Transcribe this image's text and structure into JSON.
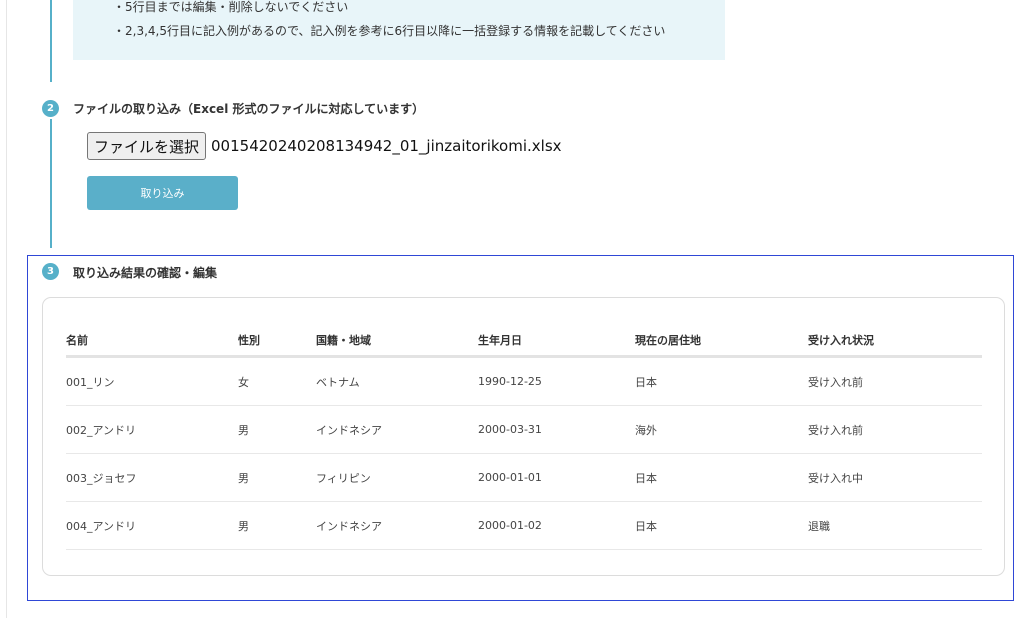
{
  "notes": [
    "・5行目までは編集・削除しないでください",
    "・2,3,4,5行目に記入例があるので、記入例を参考に6行目以降に一括登録する情報を記載してください"
  ],
  "steps": [
    {
      "number": "2",
      "title": "ファイルの取り込み（Excel 形式のファイルに対応しています）"
    },
    {
      "number": "3",
      "title": "取り込み結果の確認・編集"
    }
  ],
  "file_input": {
    "button_label": "ファイルを選択",
    "file_name": "0015420240208134942_01_jinzaitorikomi.xlsx"
  },
  "import_button_label": "取り込み",
  "table": {
    "headers": [
      "名前",
      "性別",
      "国籍・地域",
      "生年月日",
      "現在の居住地",
      "受け入れ状況"
    ],
    "rows": [
      [
        "001_リン",
        "女",
        "ベトナム",
        "1990-12-25",
        "日本",
        "受け入れ前"
      ],
      [
        "002_アンドリ",
        "男",
        "インドネシア",
        "2000-03-31",
        "海外",
        "受け入れ前"
      ],
      [
        "003_ジョセフ",
        "男",
        "フィリピン",
        "2000-01-01",
        "日本",
        "受け入れ中"
      ],
      [
        "004_アンドリ",
        "男",
        "インドネシア",
        "2000-01-02",
        "日本",
        "退職"
      ]
    ]
  },
  "colors": {
    "accent": "#56b0c9",
    "note_background": "#e8f5f9",
    "highlight_frame": "#2f47d6"
  }
}
